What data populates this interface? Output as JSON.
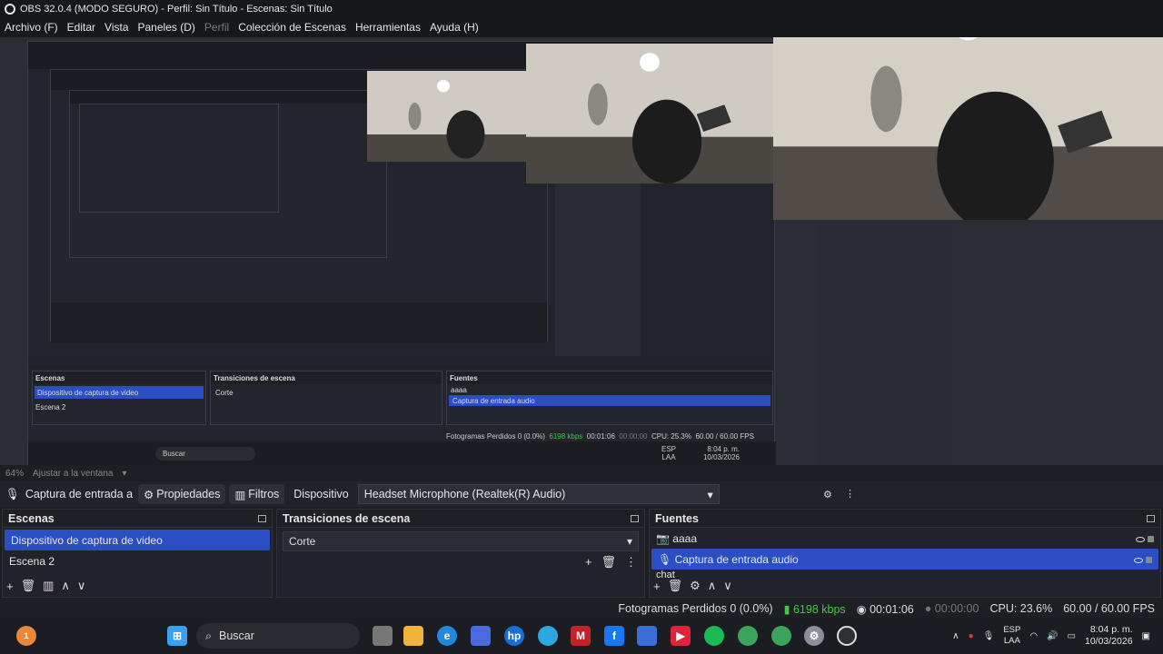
{
  "window": {
    "title": "OBS 32.0.4 (MODO SEGURO) - Perfil: Sin Título - Escenas: Sin Título"
  },
  "menu": [
    "Archivo (F)",
    "Editar",
    "Vista",
    "Paneles (D)",
    "Perfil",
    "Colección de Escenas",
    "Herramientas",
    "Ayuda (H)"
  ],
  "zoom": {
    "value": "64%",
    "fit": "Ajustar a la ventana"
  },
  "source_bar": {
    "name": "Captura de entrada a",
    "properties": "Propiedades",
    "filters": "Filtros",
    "device_label": "Dispositivo",
    "device_value": "Headset Microphone (Realtek(R) Audio)"
  },
  "docks": {
    "scenes": {
      "title": "Escenas",
      "items": [
        "Dispositivo de captura de video",
        "Escena 2"
      ],
      "selected": 0
    },
    "transitions": {
      "title": "Transiciones de escena",
      "value": "Corte"
    },
    "sources": {
      "title": "Fuentes",
      "items": [
        "aaaa",
        "Captura de entrada audio",
        "chat"
      ],
      "selected": 1
    }
  },
  "status": {
    "dropped": "Fotogramas Perdidos 0 (0.0%)",
    "kbps": "6198 kbps",
    "time1": "00:01:06",
    "time2": "00:00:00",
    "cpu": "CPU: 23.6%",
    "fps": "60.00 / 60.00 FPS"
  },
  "nested_status": {
    "dropped": "Fotogramas Perdidos 0 (0.0%)",
    "kbps": "6198 kbps",
    "time1": "00:01:06",
    "time2": "00:00:00",
    "cpu": "CPU: 25.3%",
    "fps": "60.00 / 60.00 FPS"
  },
  "taskbar": {
    "search": "Buscar",
    "badge": "1",
    "lang1": "ESP",
    "lang2": "LAA",
    "time": "8:04 p. m.",
    "date": "10/03/2026"
  },
  "nested_taskbar": {
    "search": "Buscar",
    "lang1": "ESP",
    "lang2": "LAA",
    "time": "8:04 p. m.",
    "date": "10/03/2026"
  },
  "colors": {
    "accent": "#2b4fc2",
    "bg": "#1e1f24",
    "panel": "#22232a"
  }
}
